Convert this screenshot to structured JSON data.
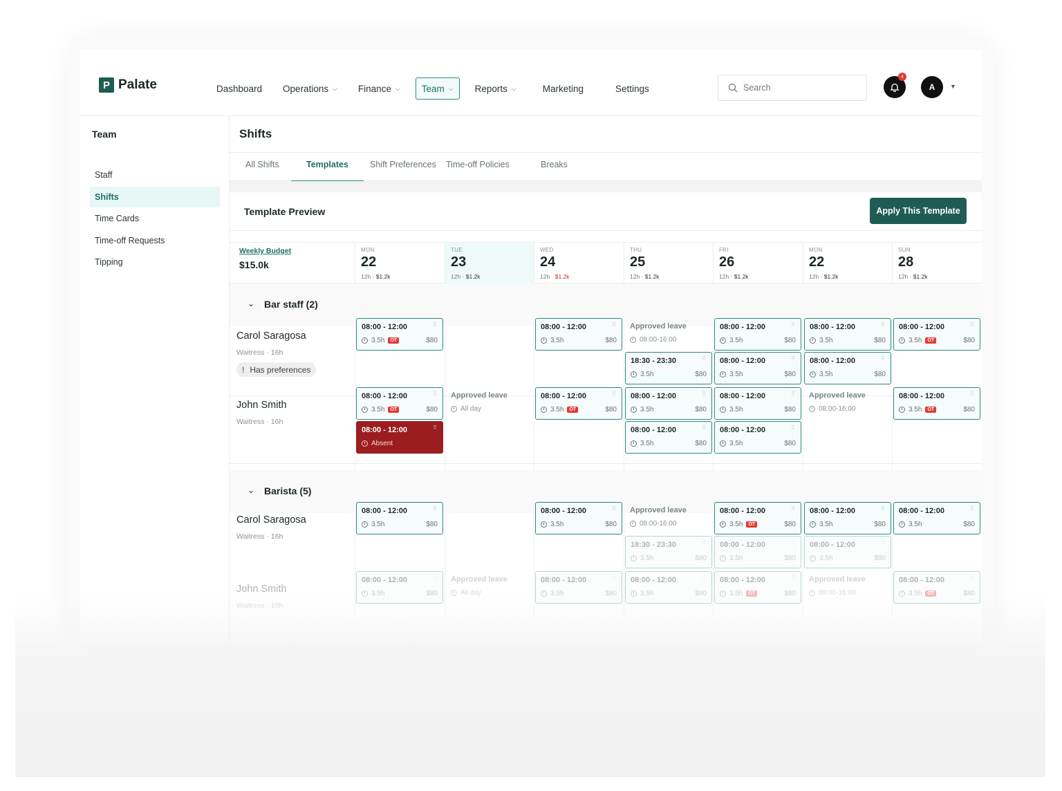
{
  "brand": {
    "name": "Palate",
    "mark": "P"
  },
  "nav": [
    {
      "label": "Dashboard",
      "dropdown": false
    },
    {
      "label": "Operations",
      "dropdown": true
    },
    {
      "label": "Finance",
      "dropdown": true
    },
    {
      "label": "Team",
      "dropdown": true,
      "active": true
    },
    {
      "label": "Reports",
      "dropdown": true
    },
    {
      "label": "Marketing",
      "dropdown": false
    },
    {
      "label": "Settings",
      "dropdown": false
    }
  ],
  "search": {
    "placeholder": "Search"
  },
  "notifications": {
    "count": "4"
  },
  "user": {
    "initial": "A"
  },
  "sidebar": {
    "title": "Team",
    "items": [
      {
        "label": "Staff"
      },
      {
        "label": "Shifts",
        "active": true
      },
      {
        "label": "Time Cards"
      },
      {
        "label": "Time-off Requests"
      },
      {
        "label": "Tipping"
      }
    ]
  },
  "page": {
    "title": "Shifts"
  },
  "tabs": [
    {
      "label": "All Shifts"
    },
    {
      "label": "Templates",
      "active": true
    },
    {
      "label": "Shift Preferences"
    },
    {
      "label": "Time-off Policies"
    },
    {
      "label": "Breaks"
    }
  ],
  "preview": {
    "title": "Template Preview",
    "apply_label": "Apply This Template"
  },
  "budget": {
    "label": "Weekly Budget",
    "value": "$15.0k"
  },
  "days": [
    {
      "name": "MON",
      "num": "22",
      "hours": "12h",
      "cost": "$1.2k",
      "over": false
    },
    {
      "name": "TUE",
      "num": "23",
      "hours": "12h",
      "cost": "$1.2k",
      "over": false,
      "highlight": true
    },
    {
      "name": "WED",
      "num": "24",
      "hours": "12h",
      "cost": "$1.2k",
      "over": true
    },
    {
      "name": "THU",
      "num": "25",
      "hours": "12h",
      "cost": "$1.2k",
      "over": false
    },
    {
      "name": "FRI",
      "num": "26",
      "hours": "12h",
      "cost": "$1.2k",
      "over": false
    },
    {
      "name": "MON",
      "num": "22",
      "hours": "12h",
      "cost": "$1.2k",
      "over": false
    },
    {
      "name": "SUN",
      "num": "28",
      "hours": "12h",
      "cost": "$1.2k",
      "over": false
    }
  ],
  "groups": [
    {
      "title": "Bar staff (2)",
      "people": [
        {
          "name": "Carol Saragosa",
          "role": "Waitress · 16h",
          "pref": "Has preferences"
        },
        {
          "name": "John Smith",
          "role": "Waitress · 16h"
        }
      ]
    },
    {
      "title": "Barista (5)",
      "people": [
        {
          "name": "Carol Saragosa",
          "role": "Waitress · 16h"
        },
        {
          "name": "John Smith",
          "role": "Waitress · 16h"
        }
      ]
    }
  ],
  "shift_text": {
    "time": "08:00 - 12:00",
    "evening": "18:30 - 23:30",
    "dur": "3.5h",
    "cost": "$80",
    "ot": "OT",
    "absent": "Absent",
    "leave_title": "Approved leave",
    "leave_time": "08:00-16:00",
    "leave_allday": "All day"
  },
  "colors": {
    "brand": "#1f5c53",
    "accent": "#2b8a80",
    "absent": "#9b1d20",
    "ot": "#e53935"
  }
}
